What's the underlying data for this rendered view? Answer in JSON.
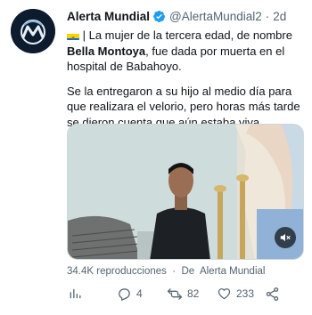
{
  "tweet": {
    "author_name": "Alerta Mundial",
    "handle": "@AlertaMundial2",
    "separator": "·",
    "time": "2d",
    "text_intro": " | La mujer de la tercera edad, de nombre ",
    "text_name": "Bella Montoya",
    "text_rest": ", fue dada por muerta en el hospital de Babahoyo.",
    "text_p2": "Se la entregaron a su hijo al medio día para que realizara el velorio, pero horas más tarde se dieron cuenta que aún estaba viva."
  },
  "media": {
    "meta": "34.4K reproducciones  ·  De  Alerta Mundial"
  },
  "actions": {
    "analytics_icon": "analytics-icon",
    "reply_count": "4",
    "retweet_count": "82",
    "like_count": "233",
    "share_icon": "share-icon"
  },
  "colors": {
    "verified": "#1d9bf0",
    "muted_text": "#536471",
    "avatar_bg": "#0d1b2f"
  }
}
